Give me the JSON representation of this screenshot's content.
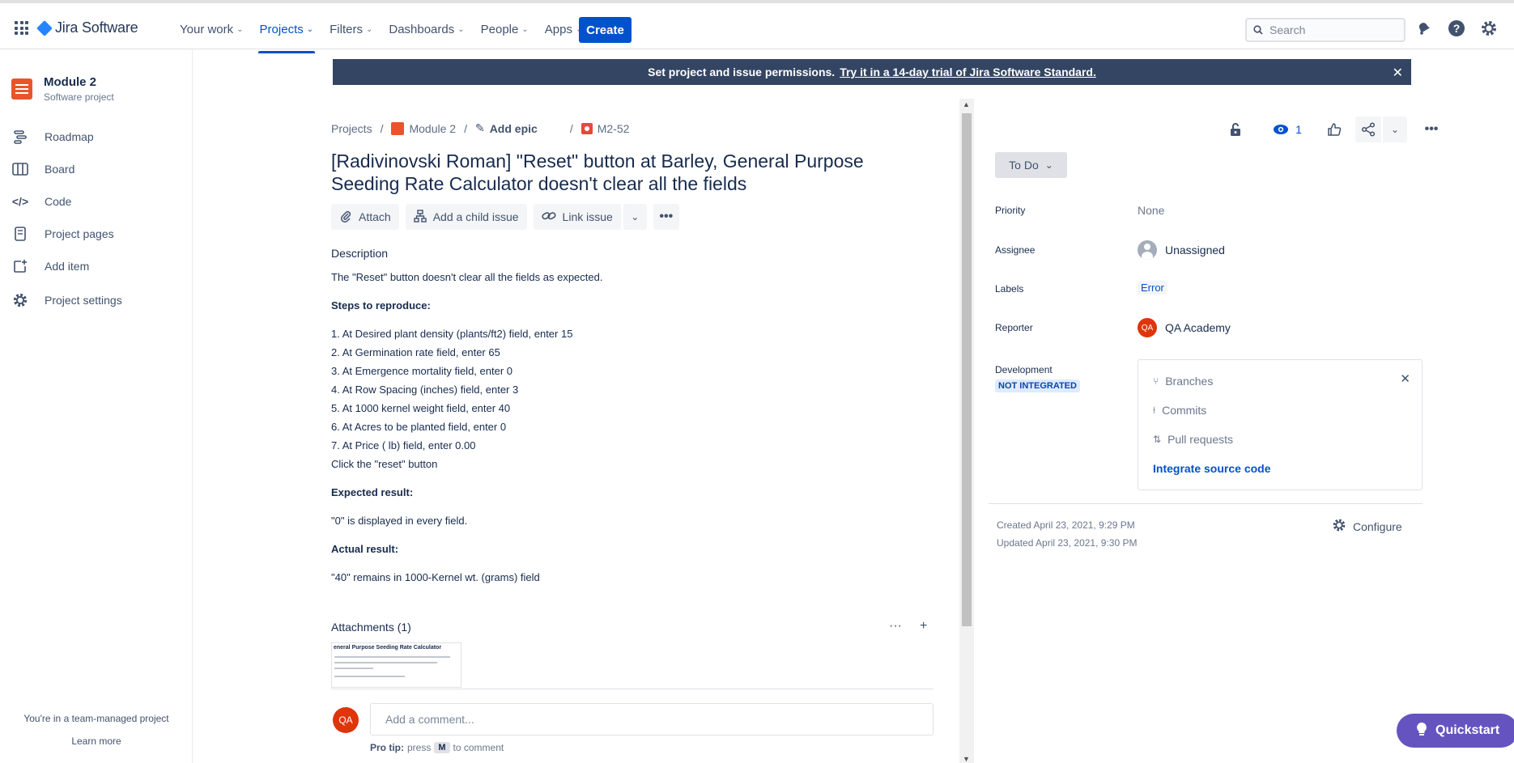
{
  "topnav": {
    "product": "Jira Software",
    "items": [
      {
        "label": "Your work",
        "active": false
      },
      {
        "label": "Projects",
        "active": true
      },
      {
        "label": "Filters",
        "active": false
      },
      {
        "label": "Dashboards",
        "active": false
      },
      {
        "label": "People",
        "active": false
      },
      {
        "label": "Apps",
        "active": false
      }
    ],
    "create_label": "Create",
    "search_placeholder": "Search"
  },
  "sidebar": {
    "project_name": "Module 2",
    "project_type": "Software project",
    "items": [
      {
        "label": "Roadmap",
        "icon": "roadmap-icon"
      },
      {
        "label": "Board",
        "icon": "board-icon"
      },
      {
        "label": "Code",
        "icon": "code-icon"
      },
      {
        "label": "Project pages",
        "icon": "pages-icon"
      },
      {
        "label": "Add item",
        "icon": "add-item-icon"
      },
      {
        "label": "Project settings",
        "icon": "gear-icon"
      }
    ],
    "footer_text": "You're in a team-managed project",
    "learn_more": "Learn more"
  },
  "banner": {
    "text": "Set project and issue permissions.",
    "link": "Try it in a 14-day trial of Jira Software Standard."
  },
  "breadcrumb": {
    "projects": "Projects",
    "project": "Module 2",
    "epic": "Add epic",
    "issue_key": "M2-52"
  },
  "issue": {
    "title": "[Radivinovski Roman] \"Reset\" button at Barley, General Purpose Seeding Rate Calculator doesn't clear all the fields",
    "actions": {
      "attach": "Attach",
      "child": "Add a child issue",
      "link": "Link issue"
    },
    "description_label": "Description",
    "description": {
      "intro": "The \"Reset\" button doesn't clear all the fields as expected.",
      "steps_heading": "Steps to reproduce:",
      "steps": [
        "1. At Desired plant density (plants/ft2) field, enter 15",
        "2. At Germination rate field, enter 65",
        "3. At Emergence mortality field, enter 0",
        "4. At Row Spacing (inches) field, enter 3",
        "5. At 1000 kernel weight field, enter 40",
        "6. At Acres to be planted field, enter 0",
        "7. At Price ( lb) field, enter 0.00",
        "Click the \"reset\" button"
      ],
      "expected_heading": "Expected result:",
      "expected": "\"0\" is displayed in every field.",
      "actual_heading": "Actual result:",
      "actual": "\"40\" remains in 1000-Kernel wt. (grams) field"
    },
    "attachments_label": "Attachments (1)",
    "attachment_thumb_title": "eneral Purpose Seeding Rate Calculator",
    "comment_avatar": "QA",
    "comment_placeholder": "Add a comment...",
    "protip_prefix": "Pro tip:",
    "protip_press": "press",
    "protip_key": "M",
    "protip_suffix": "to comment"
  },
  "right": {
    "watch_count": "1",
    "status": "To Do",
    "fields": {
      "priority_label": "Priority",
      "priority_value": "None",
      "assignee_label": "Assignee",
      "assignee_value": "Unassigned",
      "labels_label": "Labels",
      "labels_value": "Error",
      "reporter_label": "Reporter",
      "reporter_initials": "QA",
      "reporter_value": "QA Academy",
      "development_label": "Development",
      "not_integrated": "NOT INTEGRATED"
    },
    "dev": {
      "branches": "Branches",
      "commits": "Commits",
      "pull_requests": "Pull requests",
      "integrate": "Integrate source code"
    },
    "created": "Created April 23, 2021, 9:29 PM",
    "updated": "Updated April 23, 2021, 9:30 PM",
    "configure": "Configure"
  },
  "quickstart": "Quickstart",
  "colors": {
    "brand_blue": "#0052cc",
    "banner_bg": "#344563",
    "project_orange": "#e9552a",
    "quickstart_purple": "#6554c0"
  }
}
